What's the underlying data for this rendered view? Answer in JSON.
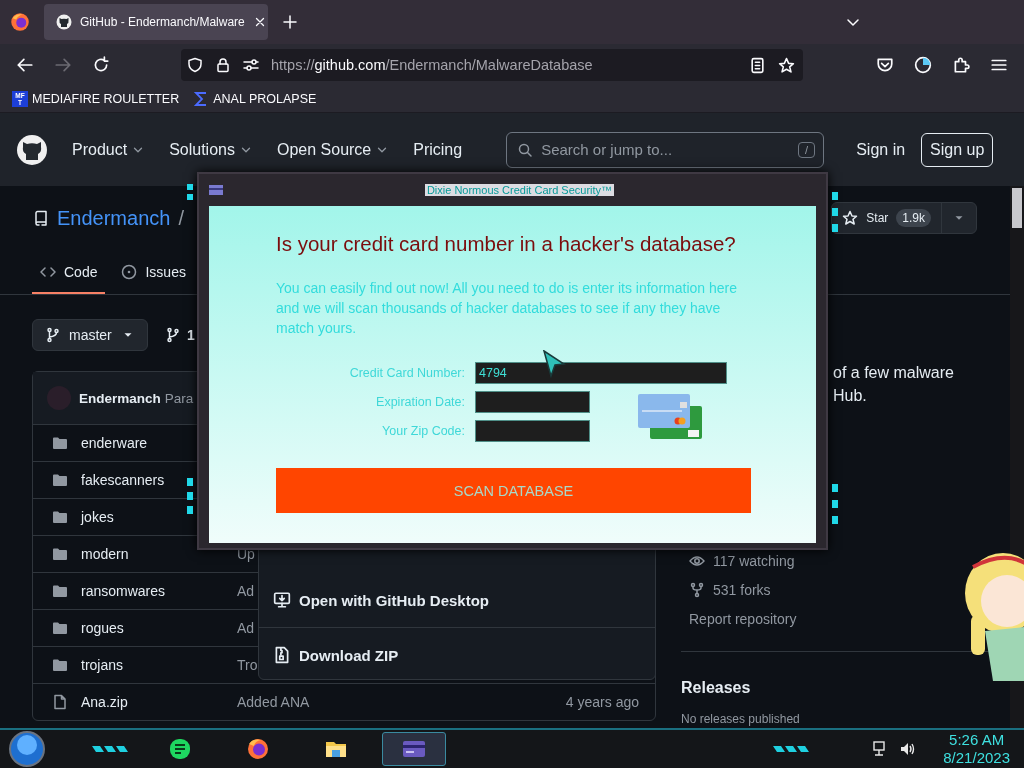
{
  "browser": {
    "tabs": [
      {
        "title": "GitHub - Endermanch/Malware",
        "selected": true
      }
    ],
    "address": {
      "scheme": "https://",
      "host": "github.com",
      "path": "/Endermanch/MalwareDatabase"
    },
    "forward_disabled": true,
    "bookmarks": [
      {
        "label": "MEDIAFIRE ROULETTER",
        "kind": "letters",
        "icon_text": [
          "MF",
          "T"
        ]
      },
      {
        "label": "ANAL PROLAPSE",
        "kind": "sigma"
      }
    ]
  },
  "github": {
    "nav": [
      {
        "label": "Product",
        "menu": true
      },
      {
        "label": "Solutions",
        "menu": true
      },
      {
        "label": "Open Source",
        "menu": true
      },
      {
        "label": "Pricing",
        "menu": false
      }
    ],
    "search": {
      "placeholder": "Search or jump to...",
      "shortcut": "/"
    },
    "sign_in": "Sign in",
    "sign_up": "Sign up"
  },
  "repo": {
    "owner": "Endermanch",
    "separator": "/",
    "star": {
      "label": "Star",
      "count": "1.9k"
    },
    "tabs": [
      {
        "label": "Code",
        "kind": "code",
        "selected": true
      },
      {
        "label": "Issues",
        "kind": "issues",
        "selected": false
      }
    ],
    "branch": "master",
    "branch_count": "1",
    "latest_commit": {
      "author": "Endermanch",
      "message": "Para"
    },
    "files": [
      {
        "name": "enderware",
        "kind": "folder"
      },
      {
        "name": "fakescanners",
        "kind": "folder"
      },
      {
        "name": "jokes",
        "kind": "folder"
      },
      {
        "name": "modern",
        "kind": "folder",
        "message": "Up"
      },
      {
        "name": "ransomwares",
        "kind": "folder",
        "message": "Ad"
      },
      {
        "name": "rogues",
        "kind": "folder",
        "message": "Ad"
      },
      {
        "name": "trojans",
        "kind": "folder",
        "message": "Tro"
      },
      {
        "name": "Ana.zip",
        "kind": "file",
        "message": "Added ANA",
        "time": "4 years ago"
      }
    ],
    "about": [
      "of a few malware",
      "Hub."
    ],
    "stats": [
      {
        "kind": "watch",
        "text": "117 watching"
      },
      {
        "kind": "fork",
        "text": "531 forks"
      }
    ],
    "report": "Report repository",
    "releases": {
      "title": "Releases",
      "note": "No releases published"
    }
  },
  "clone_menu": [
    {
      "kind": "desktop",
      "label": "Open with GitHub Desktop"
    },
    {
      "kind": "zip",
      "label": "Download ZIP"
    }
  ],
  "popup": {
    "title": "Dixie Normous Credit Card Security™",
    "heading": "Is your credit card number in a hacker's database?",
    "text": "You can easily find out now! All you need to do is enter its information here and we will scan thousands of hacker databases to see if any they have match yours.",
    "fields": [
      {
        "label": "Credit Card Number:",
        "value": "4794",
        "kind": "wide"
      },
      {
        "label": "Expiration Date:",
        "kind": "short"
      },
      {
        "label": "Your Zip Code:",
        "kind": "short"
      }
    ],
    "button": "SCAN DATABASE"
  },
  "taskbar": {
    "apps": [
      {
        "kind": "notes",
        "selected": false
      },
      {
        "kind": "firefox",
        "selected": false
      },
      {
        "kind": "explorer",
        "selected": false
      },
      {
        "kind": "card",
        "selected": true
      }
    ],
    "time": "5:26 AM",
    "date": "8/21/2023"
  }
}
